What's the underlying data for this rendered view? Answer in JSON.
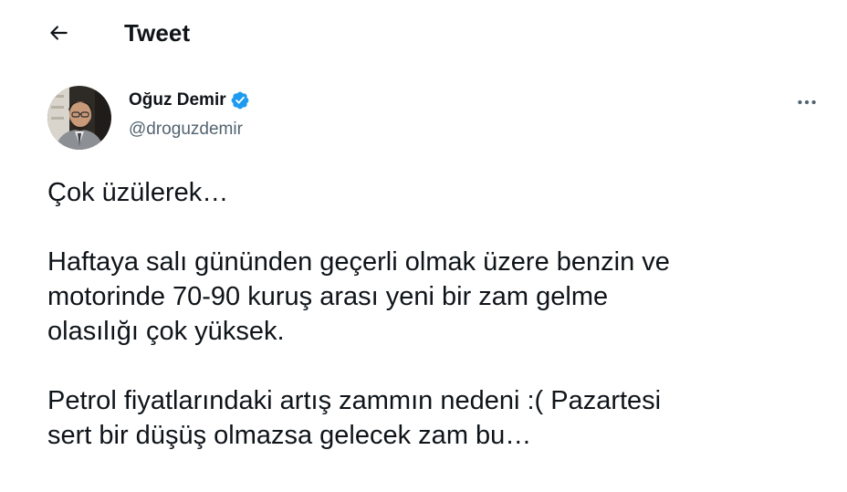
{
  "header": {
    "back_icon": "arrow-left-icon",
    "title": "Tweet"
  },
  "author": {
    "display_name": "Oğuz Demir",
    "verified_icon": "verified-badge-icon",
    "verified_color": "#1d9bf0",
    "handle": "@droguzdemir",
    "more_icon": "more-horizontal-icon"
  },
  "tweet": {
    "paragraphs": [
      "Çok üzülerek…",
      "Haftaya salı gününden geçerli olmak üzere benzin ve\nmotorinde 70-90 kuruş arası yeni bir zam gelme\nolasılığı çok yüksek.",
      "Petrol fiyatlarındaki artış zammın nedeni :( Pazartesi\nsert bir düşüş olmazsa gelecek zam bu…"
    ]
  },
  "colors": {
    "text": "#0f1419",
    "secondary": "#536471",
    "accent": "#1d9bf0"
  }
}
